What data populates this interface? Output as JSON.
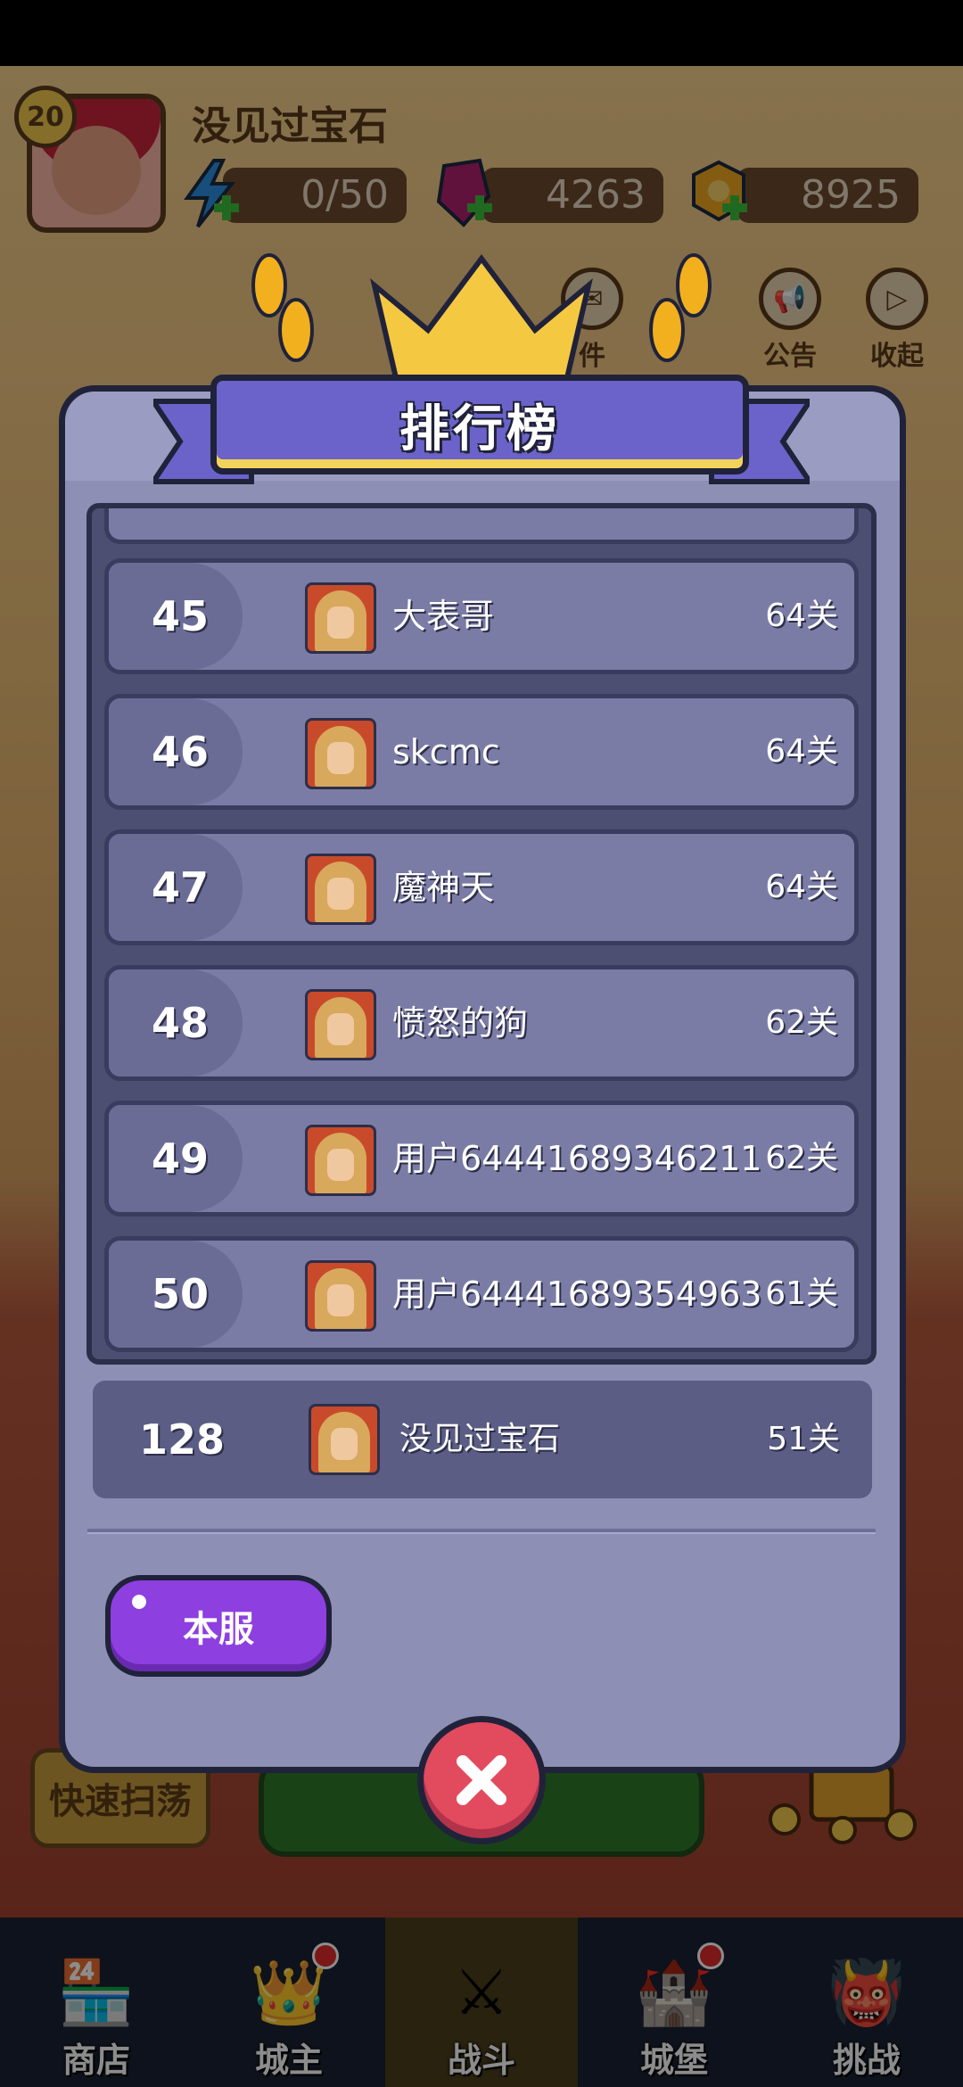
{
  "header": {
    "level": "20",
    "player_name": "没见过宝石",
    "energy": "0/50",
    "gems": "4263",
    "coins": "8925",
    "buttons": [
      {
        "label": "件",
        "icon": "mail-icon"
      },
      {
        "label": "公告",
        "icon": "megaphone-icon"
      },
      {
        "label": "收起",
        "icon": "collapse-icon"
      }
    ]
  },
  "modal": {
    "title": "排行榜",
    "rows": [
      {
        "rank": "45",
        "name": "大表哥",
        "stage": "64关"
      },
      {
        "rank": "46",
        "name": "skcmc",
        "stage": "64关"
      },
      {
        "rank": "47",
        "name": "魔神天",
        "stage": "64关"
      },
      {
        "rank": "48",
        "name": "愤怒的狗",
        "stage": "62关"
      },
      {
        "rank": "49",
        "name": "用户64441689346211",
        "stage": "62关"
      },
      {
        "rank": "50",
        "name": "用户64441689354963",
        "stage": "61关"
      }
    ],
    "my_rank": {
      "rank": "128",
      "name": "没见过宝石",
      "stage": "51关"
    },
    "server_button": "本服"
  },
  "background": {
    "quick_sweep": "快速扫荡"
  },
  "bottom_nav": [
    {
      "label": "商店",
      "icon": "shop-icon",
      "active": false
    },
    {
      "label": "城主",
      "icon": "crown-icon",
      "active": false
    },
    {
      "label": "战斗",
      "icon": "swords-icon",
      "active": true
    },
    {
      "label": "城堡",
      "icon": "castle-icon",
      "active": false
    },
    {
      "label": "挑战",
      "icon": "demon-icon",
      "active": false
    }
  ],
  "colors": {
    "modal_bg": "#8e8fb5",
    "banner": "#6b63c9",
    "server_button": "#8d3fe0",
    "close_button": "#e24a5e",
    "nav_bg": "#1b2233"
  }
}
